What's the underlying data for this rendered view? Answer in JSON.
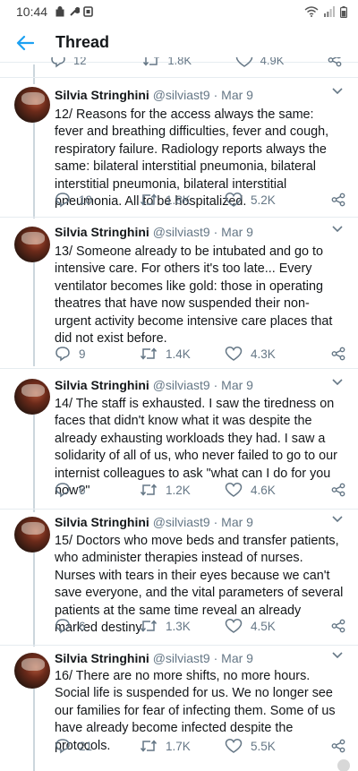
{
  "status": {
    "time": "10:44"
  },
  "header": {
    "title": "Thread"
  },
  "prev": {
    "replies": "12",
    "retweets": "1.8K",
    "likes": "4.9K"
  },
  "tweets": [
    {
      "name": "Silvia Stringhini",
      "handle": "@silviast9",
      "sep": "·",
      "date": "Mar 9",
      "text": "12/ Reasons for the access always the same: fever and breathing difficulties, fever and cough, respiratory failure. Radiology reports always the same: bilateral interstitial pneumonia, bilateral interstitial pneumonia, bilateral interstitial pneumonia. All to be hospitalized.",
      "replies": "10",
      "retweets": "1.8K",
      "likes": "5.2K"
    },
    {
      "name": "Silvia Stringhini",
      "handle": "@silviast9",
      "sep": "·",
      "date": "Mar 9",
      "text": "13/ Someone already to be intubated and go to intensive care. For others it's too late... Every ventilator becomes like gold: those in operating theatres that have now suspended their non-urgent activity become intensive care places that did not exist before.",
      "replies": "9",
      "retweets": "1.4K",
      "likes": "4.3K"
    },
    {
      "name": "Silvia Stringhini",
      "handle": "@silviast9",
      "sep": "·",
      "date": "Mar 9",
      "text": "14/ The staff is exhausted. I saw the tiredness on faces that didn't know what it was despite the already exhausting workloads they had. I saw a solidarity of all of us, who never failed to go to our internist colleagues to ask \"what can I do for you now?\"",
      "replies": "6",
      "retweets": "1.2K",
      "likes": "4.6K"
    },
    {
      "name": "Silvia Stringhini",
      "handle": "@silviast9",
      "sep": "·",
      "date": "Mar 9",
      "text": "15/ Doctors who move beds and transfer patients, who administer therapies instead of nurses. Nurses with tears in their eyes because we can't save everyone, and the vital parameters of several patients at the same time reveal an already marked destiny.",
      "replies": "6",
      "retweets": "1.3K",
      "likes": "4.5K"
    },
    {
      "name": "Silvia Stringhini",
      "handle": "@silviast9",
      "sep": "·",
      "date": "Mar 9",
      "text": "16/ There are no more shifts, no more hours. Social life is suspended for us. We no longer see our families for fear of infecting them. Some of us have already become infected despite the protocols.",
      "replies": "21",
      "retweets": "1.7K",
      "likes": "5.5K"
    }
  ]
}
